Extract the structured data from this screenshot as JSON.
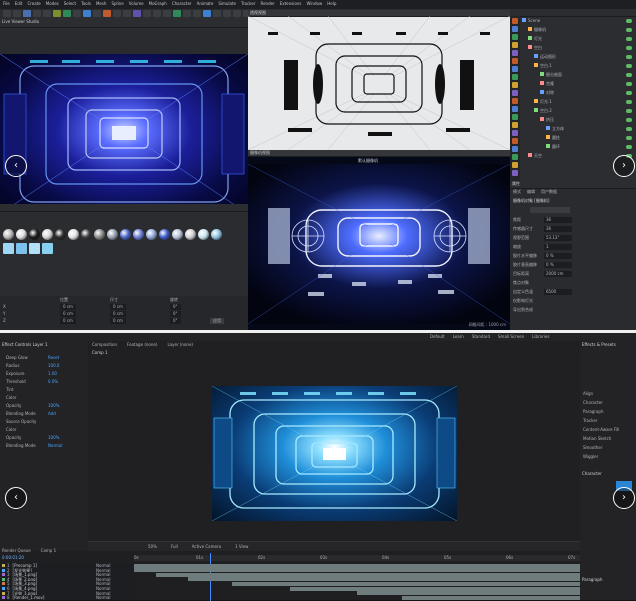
{
  "c4d": {
    "menu": [
      "File",
      "Edit",
      "Create",
      "Modes",
      "Select",
      "Tools",
      "Mesh",
      "Spline",
      "Volume",
      "MoGraph",
      "Character",
      "Animate",
      "Simulate",
      "Tracker",
      "Render",
      "Extensions",
      "Window",
      "Help"
    ],
    "left_viewport_label": "Live Viewer Studio",
    "viewport_top_label": "透视视图",
    "viewport_bottom_label": "摄像机视图",
    "camera_label": "默认摄像机",
    "grid_label": "网格间距 : 1000 cm",
    "attributes_title": "属性",
    "attributes_tabs": [
      "模式",
      "编辑",
      "用户数据"
    ],
    "attributes_object": "摄像机对象 [摄像机]",
    "attributes_rows": [
      {
        "label": "焦距",
        "value": "36"
      },
      {
        "label": "传感器尺寸",
        "value": "36"
      },
      {
        "label": "视野范围",
        "value": "53.13°"
      },
      {
        "label": "缩放",
        "value": "1"
      },
      {
        "label": "胶片水平偏移",
        "value": "0 %"
      },
      {
        "label": "胶片垂直偏移",
        "value": "0 %"
      },
      {
        "label": "目标距离",
        "value": "2000 cm"
      },
      {
        "label": "焦点对象",
        "value": ""
      },
      {
        "label": "自定义色温",
        "value": "6500"
      },
      {
        "label": "仅影响灯光",
        "value": ""
      },
      {
        "label": "导出到合成",
        "value": ""
      }
    ],
    "object_tree": [
      "Scene",
      "摄像机",
      "灯光",
      "空白",
      "运动图形",
      "空白.1",
      "细分曲面",
      "克隆",
      "对称",
      "灯光.1",
      "空白.2",
      "挤压",
      "立方体",
      "圆柱",
      "圆环",
      "天空"
    ],
    "coord_rows": [
      {
        "label": "X",
        "pos": "0 cm",
        "size": "0 cm",
        "rot": "0°"
      },
      {
        "label": "Y",
        "pos": "0 cm",
        "size": "0 cm",
        "rot": "0°"
      },
      {
        "label": "Z",
        "pos": "0 cm",
        "size": "0 cm",
        "rot": "0°"
      }
    ],
    "coord_headers": [
      "位置",
      "尺寸",
      "旋转"
    ],
    "apply_label": "应用"
  },
  "ae": {
    "menu": [
      "Default",
      "Learn",
      "Standard",
      "Small Screen",
      "Libraries"
    ],
    "effects_panel_title": "Effect Controls  Layer 1",
    "effects": [
      {
        "label": "Deep Glow",
        "value": "Reset"
      },
      {
        "label": "Radius",
        "value": "100.0"
      },
      {
        "label": "Exposure",
        "value": "1.00"
      },
      {
        "label": "Threshold",
        "value": "0.0%"
      },
      {
        "label": "Tint",
        "value": ""
      },
      {
        "label": "Color",
        "value": ""
      },
      {
        "label": "Opacity",
        "value": "100%"
      },
      {
        "label": "Blending Mode",
        "value": "Add"
      },
      {
        "label": "Source Opacity",
        "value": ""
      },
      {
        "label": "Color",
        "value": ""
      },
      {
        "label": "Opacity",
        "value": "100%"
      },
      {
        "label": "Blending Mode",
        "value": "Normal"
      }
    ],
    "comp_tabs": [
      "Composition",
      "Footage (none)",
      "Layer (none)"
    ],
    "comp_name": "Comp 1",
    "comp_footer": [
      "50%",
      "Full",
      "Active Camera",
      "1 View"
    ],
    "timecode": "0:00:01:20",
    "timeline_tabs": [
      "Render Queue",
      "Comp 1"
    ],
    "layers": [
      {
        "num": "1",
        "name": "[Precomp 1]",
        "mode": "Normal"
      },
      {
        "num": "2",
        "name": "[发光效果]",
        "mode": "Normal"
      },
      {
        "num": "3",
        "name": "[场景_1.png]",
        "mode": "Normal"
      },
      {
        "num": "4",
        "name": "[场景_2.png]",
        "mode": "Normal"
      },
      {
        "num": "5",
        "name": "[场景_3.png]",
        "mode": "Normal"
      },
      {
        "num": "6",
        "name": "[场景_4.png]",
        "mode": "Normal"
      },
      {
        "num": "7",
        "name": "[光效_1.png]",
        "mode": "Normal"
      },
      {
        "num": "8",
        "name": "[Render_1.mov]",
        "mode": "Normal"
      }
    ],
    "ruler_ticks": [
      "0s",
      "01s",
      "02s",
      "03s",
      "04s",
      "05s",
      "06s",
      "07s"
    ],
    "right_panel_title": "Effects & Presets",
    "right_panel_rows": [
      "Align",
      "Character",
      "Paragraph",
      "Tracker",
      "Content-Aware Fill",
      "Motion Sketch",
      "Smoother",
      "Wiggler"
    ],
    "character_title": "Character",
    "paragraph_title": "Paragraph"
  },
  "nav": {
    "left": "‹",
    "right": "›"
  }
}
